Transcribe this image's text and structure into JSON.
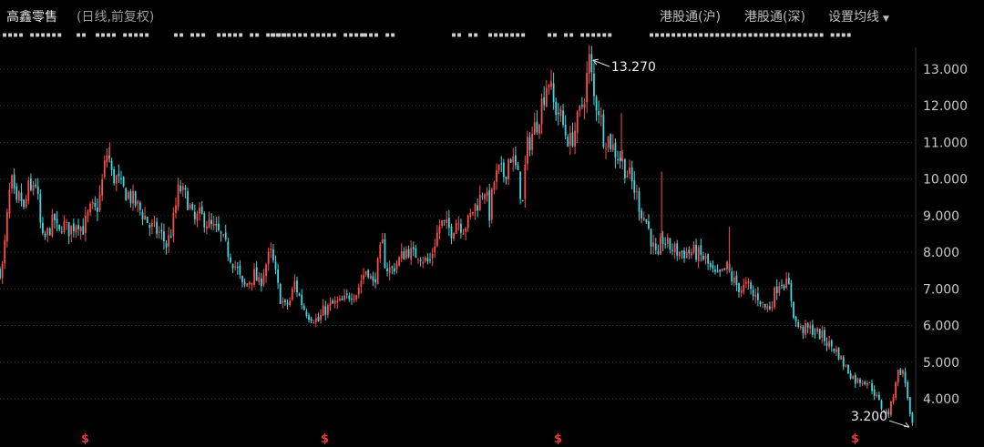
{
  "header": {
    "stock_name": "高鑫零售",
    "chart_mode": "(日线,前复权)",
    "nav": [
      "港股通(沪)",
      "港股通(深)",
      "设置均线"
    ]
  },
  "ticker_row": [
    "▪▪▪▪ ▪▪▪▪▪▪",
    "▪▪",
    "▪▪▪▪ ▪▪▪▪▪",
    "▪▪ ▪▪▪",
    "▪▪▪▪▪ ▪▪ ▪▪▪▪",
    "▪▪▪▪▪▪▪",
    "▪▪▪▪▪ ▪▪▪▪",
    "▪▪▪ ▪▪",
    "▪▪ ▪▪",
    "▪▪▪▪▪▪▪",
    "▪▪ ▪▪ ▪▪▪▪▪▪",
    "▪▪▪▪▪▪▪▪▪▪▪▪▪▪▪▪▪▪▪▪▪▪▪▪▪▪▪▪▪▪▪▪ ▪▪▪▪"
  ],
  "chart_data": {
    "type": "candlestick",
    "y_axis": {
      "ticks": [
        "4.000",
        "5.000",
        "6.000",
        "7.000",
        "8.000",
        "9.000",
        "10.000",
        "11.000",
        "12.000",
        "13.000"
      ],
      "ylim": [
        3.0,
        13.5
      ],
      "position": "right",
      "grid": "dotted horizontal"
    },
    "price_path": [
      [
        0,
        7.5
      ],
      [
        3,
        7.6
      ],
      [
        8,
        9.0
      ],
      [
        12,
        10.0
      ],
      [
        18,
        9.2
      ],
      [
        22,
        9.6
      ],
      [
        27,
        9.0
      ],
      [
        30,
        9.8
      ],
      [
        34,
        9.6
      ],
      [
        38,
        10.1
      ],
      [
        42,
        9.3
      ],
      [
        46,
        8.3
      ],
      [
        50,
        8.4
      ],
      [
        55,
        8.7
      ],
      [
        60,
        8.9
      ],
      [
        64,
        8.4
      ],
      [
        68,
        8.8
      ],
      [
        74,
        8.6
      ],
      [
        80,
        8.7
      ],
      [
        85,
        8.9
      ],
      [
        90,
        8.6
      ],
      [
        95,
        8.9
      ],
      [
        100,
        9.2
      ],
      [
        105,
        9.1
      ],
      [
        110,
        9.6
      ],
      [
        114,
        10.3
      ],
      [
        118,
        10.8
      ],
      [
        122,
        10.1
      ],
      [
        128,
        10.0
      ],
      [
        134,
        9.7
      ],
      [
        140,
        9.6
      ],
      [
        146,
        9.4
      ],
      [
        152,
        9.2
      ],
      [
        158,
        9.0
      ],
      [
        164,
        8.7
      ],
      [
        170,
        8.6
      ],
      [
        176,
        8.5
      ],
      [
        182,
        8.2
      ],
      [
        188,
        8.6
      ],
      [
        192,
        9.2
      ],
      [
        196,
        9.8
      ],
      [
        200,
        9.6
      ],
      [
        206,
        9.4
      ],
      [
        212,
        8.8
      ],
      [
        218,
        9.0
      ],
      [
        224,
        8.9
      ],
      [
        230,
        8.7
      ],
      [
        236,
        8.6
      ],
      [
        242,
        8.4
      ],
      [
        248,
        8.1
      ],
      [
        254,
        7.8
      ],
      [
        260,
        7.5
      ],
      [
        266,
        7.0
      ],
      [
        272,
        7.2
      ],
      [
        278,
        7.4
      ],
      [
        284,
        7.1
      ],
      [
        290,
        7.6
      ],
      [
        296,
        8.0
      ],
      [
        300,
        7.6
      ],
      [
        306,
        6.8
      ],
      [
        312,
        6.5
      ],
      [
        318,
        6.7
      ],
      [
        322,
        7.2
      ],
      [
        326,
        6.9
      ],
      [
        332,
        6.5
      ],
      [
        338,
        6.3
      ],
      [
        344,
        6.2
      ],
      [
        348,
        6.1
      ],
      [
        354,
        6.4
      ],
      [
        360,
        6.5
      ],
      [
        366,
        6.6
      ],
      [
        372,
        6.6
      ],
      [
        378,
        6.7
      ],
      [
        384,
        6.9
      ],
      [
        390,
        6.9
      ],
      [
        396,
        7.3
      ],
      [
        402,
        7.6
      ],
      [
        408,
        7.1
      ],
      [
        414,
        7.7
      ],
      [
        418,
        8.3
      ],
      [
        422,
        7.6
      ],
      [
        428,
        7.5
      ],
      [
        434,
        7.7
      ],
      [
        440,
        7.9
      ],
      [
        446,
        8.1
      ],
      [
        452,
        7.9
      ],
      [
        458,
        8.0
      ],
      [
        464,
        7.8
      ],
      [
        470,
        7.7
      ],
      [
        476,
        8.3
      ],
      [
        482,
        8.8
      ],
      [
        488,
        8.7
      ],
      [
        494,
        8.6
      ],
      [
        500,
        8.9
      ],
      [
        506,
        8.7
      ],
      [
        512,
        8.8
      ],
      [
        518,
        9.2
      ],
      [
        524,
        9.4
      ],
      [
        530,
        9.8
      ],
      [
        536,
        9.0
      ],
      [
        540,
        9.9
      ],
      [
        546,
        10.2
      ],
      [
        552,
        10.1
      ],
      [
        558,
        10.7
      ],
      [
        564,
        10.3
      ],
      [
        568,
        9.9
      ],
      [
        572,
        9.3
      ],
      [
        576,
        10.8
      ],
      [
        582,
        11.2
      ],
      [
        588,
        11.6
      ],
      [
        594,
        12.2
      ],
      [
        600,
        12.8
      ],
      [
        606,
        12.0
      ],
      [
        612,
        11.8
      ],
      [
        618,
        11.3
      ],
      [
        624,
        11.0
      ],
      [
        630,
        11.4
      ],
      [
        636,
        11.9
      ],
      [
        640,
        12.4
      ],
      [
        645,
        13.27
      ],
      [
        650,
        12.2
      ],
      [
        656,
        11.9
      ],
      [
        660,
        11.2
      ],
      [
        666,
        11.1
      ],
      [
        672,
        10.8
      ],
      [
        678,
        10.6
      ],
      [
        684,
        10.3
      ],
      [
        690,
        10.0
      ],
      [
        696,
        9.6
      ],
      [
        702,
        9.1
      ],
      [
        708,
        8.8
      ],
      [
        714,
        8.2
      ],
      [
        720,
        7.7
      ],
      [
        724,
        8.4
      ],
      [
        730,
        8.2
      ],
      [
        736,
        8.1
      ],
      [
        742,
        8.0
      ],
      [
        748,
        8.0
      ],
      [
        754,
        8.0
      ],
      [
        760,
        8.0
      ],
      [
        766,
        7.9
      ],
      [
        772,
        7.8
      ],
      [
        778,
        7.5
      ],
      [
        784,
        7.3
      ],
      [
        790,
        7.4
      ],
      [
        796,
        7.6
      ],
      [
        800,
        7.3
      ],
      [
        806,
        7.1
      ],
      [
        812,
        7.0
      ],
      [
        818,
        7.1
      ],
      [
        824,
        6.8
      ],
      [
        830,
        6.8
      ],
      [
        836,
        6.5
      ],
      [
        842,
        6.5
      ],
      [
        848,
        6.9
      ],
      [
        852,
        7.2
      ],
      [
        858,
        7.2
      ],
      [
        864,
        7.0
      ],
      [
        870,
        6.1
      ],
      [
        876,
        5.9
      ],
      [
        882,
        5.9
      ],
      [
        888,
        5.9
      ],
      [
        894,
        5.8
      ],
      [
        900,
        5.7
      ],
      [
        906,
        5.5
      ],
      [
        912,
        5.4
      ],
      [
        918,
        5.2
      ],
      [
        924,
        4.9
      ],
      [
        930,
        4.7
      ],
      [
        936,
        4.5
      ],
      [
        942,
        4.5
      ],
      [
        948,
        4.5
      ],
      [
        954,
        4.3
      ],
      [
        960,
        4.0
      ],
      [
        966,
        3.7
      ],
      [
        972,
        3.6
      ],
      [
        976,
        3.9
      ],
      [
        980,
        4.5
      ],
      [
        984,
        4.8
      ],
      [
        988,
        4.7
      ],
      [
        992,
        4.3
      ],
      [
        996,
        3.5
      ],
      [
        999,
        3.2
      ]
    ],
    "spikes": [
      {
        "x": 120,
        "high": 11.0
      },
      {
        "x": 724,
        "high": 10.2
      },
      {
        "x": 798,
        "high": 8.7
      },
      {
        "x": 680,
        "high": 11.8
      }
    ],
    "annotations": [
      {
        "label": "13.270",
        "x": 645,
        "value": 13.27,
        "side": "right"
      },
      {
        "label": "3.200",
        "x": 999,
        "value": 3.2,
        "side": "left"
      }
    ],
    "event_markers": {
      "label": "$",
      "x": [
        93,
        356,
        612,
        938
      ]
    },
    "colors": {
      "background": "#000000",
      "up": "#ff4d4d",
      "down": "#3fd7e0",
      "grid": "#3a3a3a",
      "axis_text": "#c9c9c9",
      "event_marker": "#e53935"
    }
  }
}
